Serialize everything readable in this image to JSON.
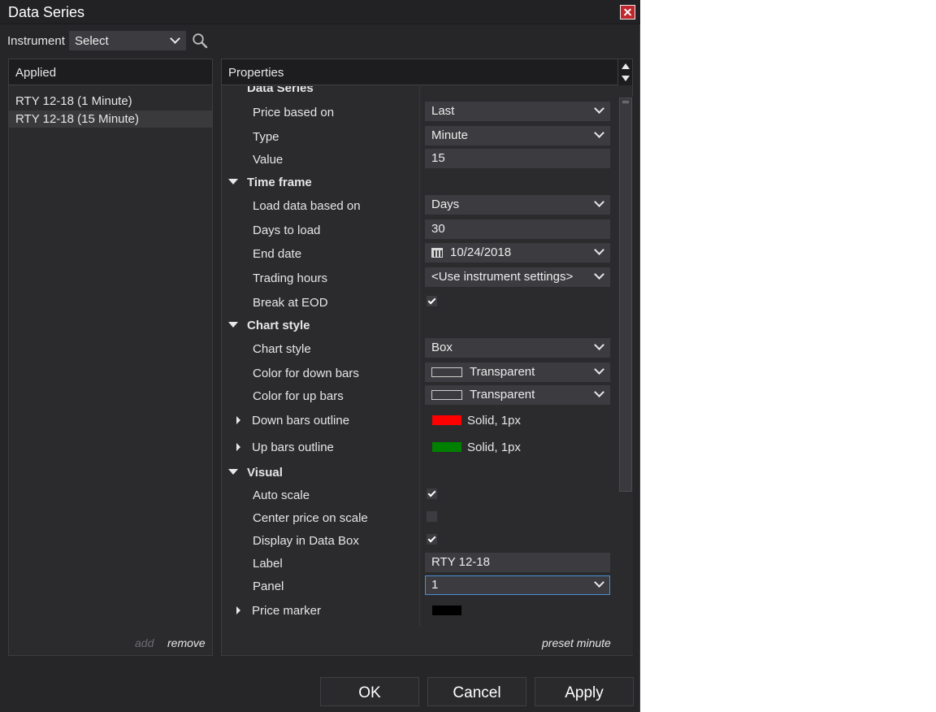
{
  "window": {
    "title": "Data Series",
    "close_icon": "close-icon"
  },
  "instrument": {
    "label": "Instrument",
    "selected": "Select"
  },
  "applied": {
    "header": "Applied",
    "items": [
      "RTY 12-18 (1 Minute)",
      "RTY 12-18 (15 Minute)"
    ],
    "add_label": "add",
    "remove_label": "remove"
  },
  "properties": {
    "header": "Properties",
    "categories": {
      "data_series": "Data Series",
      "time_frame": "Time frame",
      "chart_style": "Chart style",
      "visual": "Visual"
    },
    "rows": {
      "price_based_on": {
        "label": "Price based on",
        "value": "Last"
      },
      "type": {
        "label": "Type",
        "value": "Minute"
      },
      "value": {
        "label": "Value",
        "value": "15"
      },
      "load_data_based_on": {
        "label": "Load data based on",
        "value": "Days"
      },
      "days_to_load": {
        "label": "Days to load",
        "value": "30"
      },
      "end_date": {
        "label": "End date",
        "value": "10/24/2018"
      },
      "trading_hours": {
        "label": "Trading hours",
        "value": "<Use instrument settings>"
      },
      "break_at_eod": {
        "label": "Break at EOD",
        "checked": true
      },
      "chart_style": {
        "label": "Chart style",
        "value": "Box"
      },
      "color_down_bars": {
        "label": "Color for down bars",
        "value": "Transparent"
      },
      "color_up_bars": {
        "label": "Color for up bars",
        "value": "Transparent"
      },
      "down_bars_outline": {
        "label": "Down bars outline",
        "value": "Solid, 1px",
        "color": "#ff0000"
      },
      "up_bars_outline": {
        "label": "Up bars outline",
        "value": "Solid, 1px",
        "color": "#008000"
      },
      "auto_scale": {
        "label": "Auto scale",
        "checked": true
      },
      "center_price_on_scale": {
        "label": "Center price on scale",
        "checked": false
      },
      "display_in_data_box": {
        "label": "Display in Data Box",
        "checked": true
      },
      "label": {
        "label": "Label",
        "value": "RTY 12-18"
      },
      "panel": {
        "label": "Panel",
        "value": "1"
      },
      "price_marker": {
        "label": "Price marker",
        "color": "#000000"
      }
    },
    "preset_label": "preset minute"
  },
  "buttons": {
    "ok": "OK",
    "cancel": "Cancel",
    "apply": "Apply"
  }
}
